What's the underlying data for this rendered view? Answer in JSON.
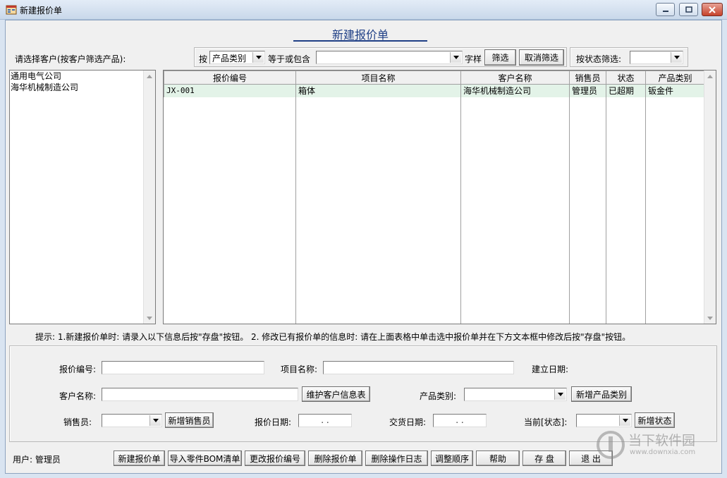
{
  "window": {
    "title": "新建报价单"
  },
  "form_title": "新建报价单",
  "select_customer_label": "请选择客户(按客户筛选产品):",
  "filter": {
    "by_label": "按",
    "field_value": "产品类别",
    "equals_label": "等于或包含",
    "text_value": "",
    "suffix_label": "字样",
    "filter_button": "筛选",
    "cancel_button": "取消筛选",
    "status_label": "按状态筛选:",
    "status_value": ""
  },
  "customers": [
    "通用电气公司",
    "海华机械制造公司"
  ],
  "grid": {
    "columns": [
      "报价编号",
      "项目名称",
      "客户名称",
      "销售员",
      "状态",
      "产品类别"
    ],
    "rows": [
      [
        "JX-001",
        "箱体",
        "海华机械制造公司",
        "管理员",
        "已超期",
        "钣金件"
      ]
    ]
  },
  "hint": "提示: 1.新建报价单时: 请录入以下信息后按\"存盘\"按钮。  2. 修改已有报价单的信息时: 请在上面表格中单击选中报价单并在下方文本框中修改后按\"存盘\"按钮。",
  "fields": {
    "quote_no_label": "报价编号:",
    "quote_no_value": "",
    "project_label": "项目名称:",
    "project_value": "",
    "created_label": "建立日期:",
    "customer_label": "客户名称:",
    "customer_value": "",
    "maintain_customer_button": "维护客户信息表",
    "product_cat_label": "产品类别:",
    "product_cat_value": "",
    "add_product_cat_button": "新增产品类别",
    "sales_label": "销售员:",
    "sales_value": "",
    "add_sales_button": "新增销售员",
    "quote_date_label": "报价日期:",
    "quote_date_value": "  .  .",
    "delivery_date_label": "交货日期:",
    "delivery_date_value": "  .  .",
    "status_label": "当前[状态]:",
    "status_value": "",
    "add_status_button": "新增状态"
  },
  "user_label": "用户: 管理员",
  "buttons": {
    "new_quote": "新建报价单",
    "import_bom": "导入零件BOM清单",
    "change_no": "更改报价编号",
    "delete_quote": "删除报价单",
    "delete_log": "删除操作日志",
    "adjust_order": "调整顺序",
    "help": "帮助",
    "save": "存 盘",
    "exit": "退 出"
  },
  "watermark": {
    "brand": "当下软件园",
    "url": "www.downxia.com"
  }
}
